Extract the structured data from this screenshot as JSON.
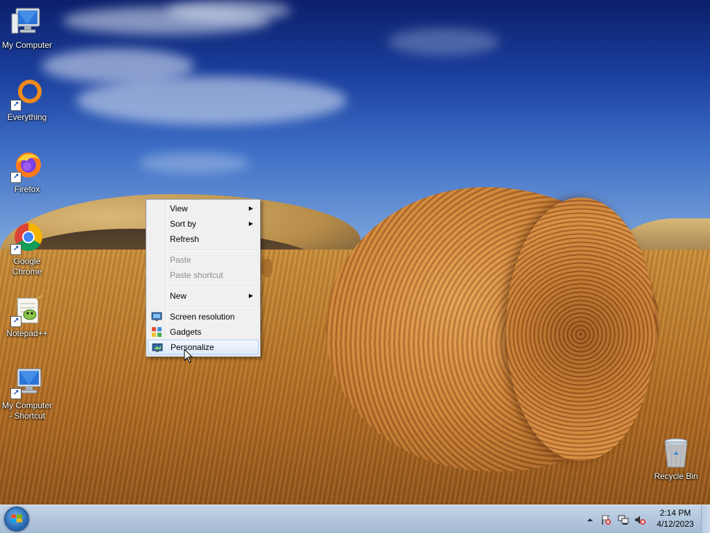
{
  "desktop_icons": [
    {
      "id": "my-computer",
      "label": "My Computer",
      "icon": "computer-icon",
      "shortcut": false
    },
    {
      "id": "everything",
      "label": "Everything",
      "icon": "everything-icon",
      "shortcut": true
    },
    {
      "id": "firefox",
      "label": "Firefox",
      "icon": "firefox-icon",
      "shortcut": true
    },
    {
      "id": "google-chrome",
      "label": "Google\nChrome",
      "icon": "chrome-icon",
      "shortcut": true
    },
    {
      "id": "notepad-plus-plus",
      "label": "Notepad++",
      "icon": "notepad-plus-plus-icon",
      "shortcut": true
    },
    {
      "id": "my-computer-shortcut",
      "label": "My Computer\n- Shortcut",
      "icon": "computer-icon",
      "shortcut": true
    },
    {
      "id": "recycle-bin",
      "label": "Recycle Bin",
      "icon": "recycle-bin-icon",
      "shortcut": false
    }
  ],
  "context_menu": {
    "items": [
      {
        "label": "View",
        "submenu": true,
        "enabled": true
      },
      {
        "label": "Sort by",
        "submenu": true,
        "enabled": true
      },
      {
        "label": "Refresh",
        "submenu": false,
        "enabled": true
      },
      {
        "label": "Paste",
        "submenu": false,
        "enabled": false
      },
      {
        "label": "Paste shortcut",
        "submenu": false,
        "enabled": false
      },
      {
        "label": "New",
        "submenu": true,
        "enabled": true
      },
      {
        "label": "Screen resolution",
        "submenu": false,
        "enabled": true,
        "icon": "screen-resolution-icon"
      },
      {
        "label": "Gadgets",
        "submenu": false,
        "enabled": true,
        "icon": "gadgets-icon"
      },
      {
        "label": "Personalize",
        "submenu": false,
        "enabled": true,
        "icon": "personalize-icon",
        "highlighted": true
      }
    ]
  },
  "taskbar": {
    "start_icon": "windows-start-orb-icon",
    "tray_icons": [
      "show-hidden-icons-chevron",
      "action-center-flag-icon",
      "network-icon",
      "volume-muted-icon"
    ],
    "clock": {
      "time": "2:14 PM",
      "date": "4/12/2023"
    }
  },
  "colors": {
    "taskbar": "#b4c8de",
    "menu_background": "#f0f0f0",
    "menu_highlight_border": "#aecff7",
    "disabled_text": "#8d8d8d"
  }
}
